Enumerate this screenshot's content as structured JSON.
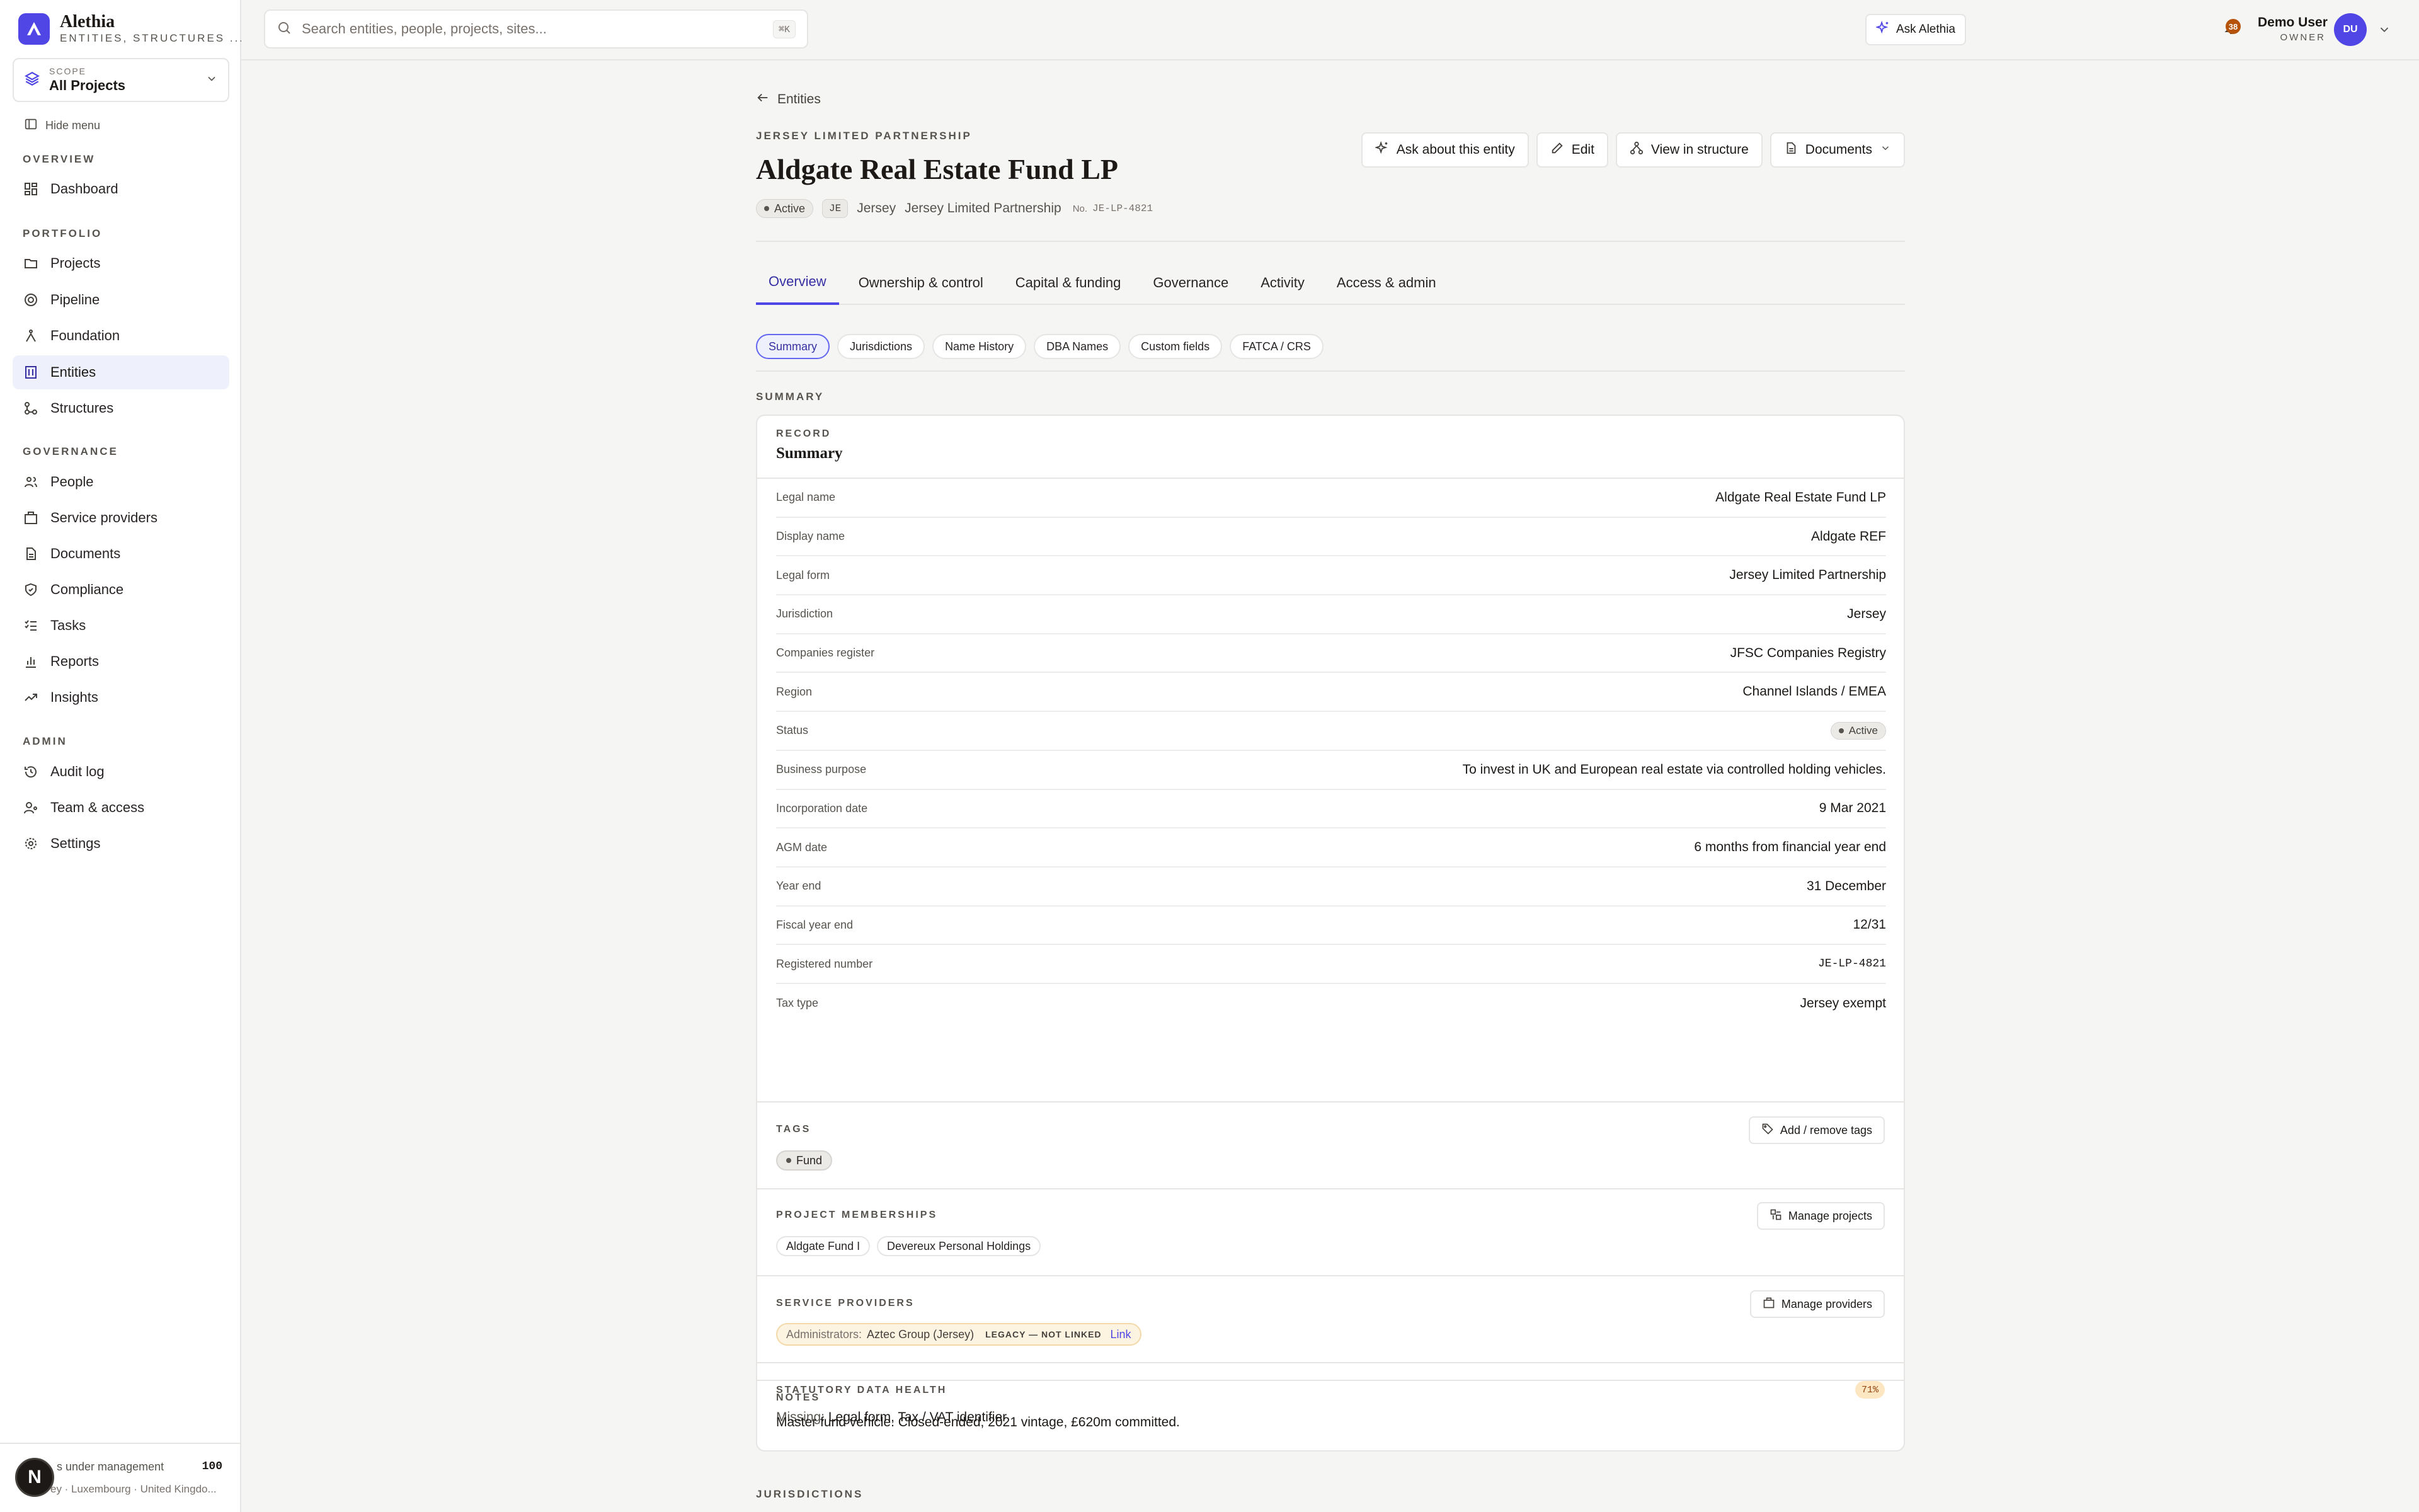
{
  "brand": {
    "name": "Alethia",
    "tagline": "ENTITIES, STRUCTURES ..."
  },
  "scope": {
    "label": "SCOPE",
    "value": "All Projects"
  },
  "sidebar": {
    "hide_menu": "Hide menu",
    "sections": {
      "overview": "OVERVIEW",
      "portfolio": "PORTFOLIO",
      "governance": "GOVERNANCE",
      "admin": "ADMIN"
    },
    "items": {
      "dashboard": "Dashboard",
      "projects": "Projects",
      "pipeline": "Pipeline",
      "foundation": "Foundation",
      "entities": "Entities",
      "structures": "Structures",
      "people": "People",
      "service_providers": "Service providers",
      "documents": "Documents",
      "compliance": "Compliance",
      "tasks": "Tasks",
      "reports": "Reports",
      "insights": "Insights",
      "audit_log": "Audit log",
      "team_access": "Team & access",
      "settings": "Settings"
    },
    "footer": {
      "aum_label": "s under management",
      "aum_count": "100",
      "jurisdictions": "ey · Luxembourg · United Kingdo..."
    },
    "n_badge": "N"
  },
  "topbar": {
    "search_placeholder": "Search entities, people, projects, sites...",
    "search_shortcut": "⌘K",
    "ask_label": "Ask Alethia",
    "notification_count": "38",
    "user_name": "Demo User",
    "user_role": "OWNER",
    "user_initials": "DU"
  },
  "entity": {
    "back_label": "Entities",
    "kicker": "JERSEY LIMITED PARTNERSHIP",
    "title": "Aldgate Real Estate Fund LP",
    "status": "Active",
    "country_code": "JE",
    "jurisdiction": "Jersey",
    "legal_form": "Jersey Limited Partnership",
    "no_label": "No.",
    "number": "JE-LP-4821"
  },
  "actions": {
    "ask": "Ask about this entity",
    "edit": "Edit",
    "view_structure": "View in structure",
    "documents": "Documents"
  },
  "tabs": [
    "Overview",
    "Ownership & control",
    "Capital & funding",
    "Governance",
    "Activity",
    "Access & admin"
  ],
  "subtabs": [
    "Summary",
    "Jurisdictions",
    "Name History",
    "DBA Names",
    "Custom fields",
    "FATCA / CRS"
  ],
  "summary_section_label": "SUMMARY",
  "record": {
    "label": "RECORD",
    "title": "Summary",
    "fields": [
      {
        "k": "Legal name",
        "v": "Aldgate Real Estate Fund LP"
      },
      {
        "k": "Display name",
        "v": "Aldgate REF"
      },
      {
        "k": "Legal form",
        "v": "Jersey Limited Partnership"
      },
      {
        "k": "Jurisdiction",
        "v": "Jersey"
      },
      {
        "k": "Companies register",
        "v": "JFSC Companies Registry"
      },
      {
        "k": "Region",
        "v": "Channel Islands / EMEA"
      },
      {
        "k": "Status",
        "v": "Active"
      },
      {
        "k": "Business purpose",
        "v": "To invest in UK and European real estate via controlled holding vehicles."
      },
      {
        "k": "Incorporation date",
        "v": "9 Mar 2021"
      },
      {
        "k": "AGM date",
        "v": "6 months from financial year end"
      },
      {
        "k": "Year end",
        "v": "31 December"
      },
      {
        "k": "Fiscal year end",
        "v": "12/31"
      },
      {
        "k": "Registered number",
        "v": "JE-LP-4821"
      },
      {
        "k": "Tax type",
        "v": "Jersey exempt"
      }
    ]
  },
  "tags": {
    "label": "TAGS",
    "button": "Add / remove tags",
    "items": [
      "Fund"
    ]
  },
  "projects": {
    "label": "PROJECT MEMBERSHIPS",
    "button": "Manage projects",
    "items": [
      "Aldgate Fund I",
      "Devereux Personal Holdings"
    ]
  },
  "providers": {
    "label": "SERVICE PROVIDERS",
    "button": "Manage providers",
    "role": "Administrators:",
    "name": "Aztec Group (Jersey)",
    "legacy": "LEGACY — NOT LINKED",
    "link": "Link"
  },
  "health": {
    "label": "STATUTORY DATA HEALTH",
    "percent": "71%",
    "missing_label": "Missing:",
    "missing_value": "Legal form, Tax / VAT identifier"
  },
  "notes": {
    "label": "NOTES",
    "text": "Master fund vehicle. Closed-ended, 2021 vintage, £620m committed."
  },
  "jurisdictions_section_label": "JURISDICTIONS",
  "colors": {
    "accent": "#4f46e5",
    "background": "#f5f5f4",
    "surface": "#ffffff",
    "warning": "#b45309"
  }
}
